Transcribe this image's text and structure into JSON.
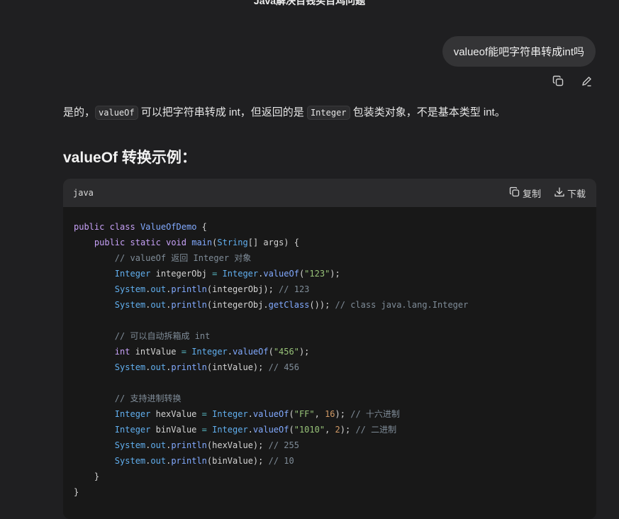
{
  "conversation": {
    "title": "Java解决百钱买百鸡问题"
  },
  "user_message": {
    "text": "valueof能吧字符串转成int吗",
    "copy_icon": "copy-icon",
    "edit_icon": "edit-icon"
  },
  "answer": {
    "intro_before": "是的，",
    "intro_code1": "valueOf",
    "intro_middle": " 可以把字符串转成 int，但返回的是 ",
    "intro_code2": "Integer",
    "intro_after": " 包装类对象，不是基本类型 int。",
    "heading": "valueOf 转换示例："
  },
  "code_block": {
    "language": "java",
    "copy_label": "复制",
    "download_label": "下载",
    "copy_icon": "copy-icon",
    "download_icon": "download-icon",
    "lines": [
      "public class ValueOfDemo {",
      "    public static void main(String[] args) {",
      "        // valueOf 返回 Integer 对象",
      "        Integer integerObj = Integer.valueOf(\"123\");",
      "        System.out.println(integerObj); // 123",
      "        System.out.println(integerObj.getClass()); // class java.lang.Integer",
      "",
      "        // 可以自动拆箱成 int",
      "        int intValue = Integer.valueOf(\"456\");",
      "        System.out.println(intValue); // 456",
      "",
      "        // 支持进制转换",
      "        Integer hexValue = Integer.valueOf(\"FF\", 16); // 十六进制",
      "        Integer binValue = Integer.valueOf(\"1010\", 2); // 二进制",
      "        System.out.println(hexValue); // 255",
      "        System.out.println(binValue); // 10",
      "    }",
      "}"
    ]
  },
  "colors": {
    "background": "#1f1f21",
    "bubble": "#343436",
    "code_bg": "#181818",
    "code_header": "#2b2b2d"
  }
}
